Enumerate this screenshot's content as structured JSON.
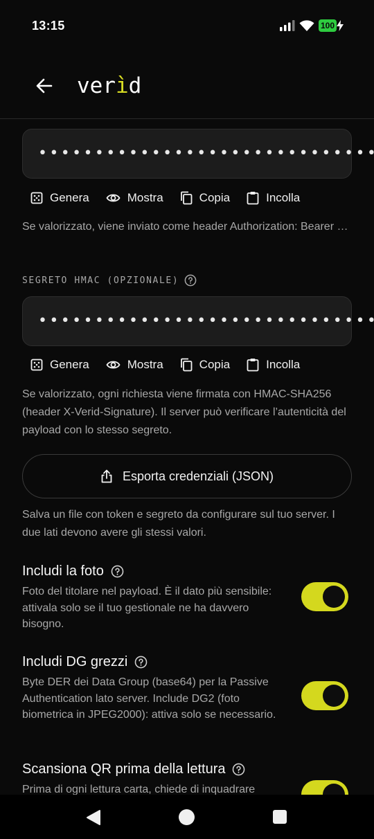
{
  "status": {
    "time": "13:15",
    "battery": "100"
  },
  "appbar": {
    "brand_prefix": "ver",
    "brand_accent": "ì",
    "brand_suffix": "d"
  },
  "token": {
    "masked_value": "••••••••••••••••••••••••••••••••",
    "actions": {
      "generate": "Genera",
      "show": "Mostra",
      "copy": "Copia",
      "paste": "Incolla"
    },
    "help": "Se valorizzato, viene inviato come header Authorization: Bearer …"
  },
  "hmac": {
    "label": "SEGRETO HMAC (OPZIONALE)",
    "masked_value": "••••••••••••••••••••••••••••••••",
    "actions": {
      "generate": "Genera",
      "show": "Mostra",
      "copy": "Copia",
      "paste": "Incolla"
    },
    "help": "Se valorizzato, ogni richiesta viene firmata con HMAC-SHA256 (header X-Verid-Signature). Il server può verificare l’autenticità del payload con lo stesso segreto."
  },
  "export": {
    "button_label": "Esporta credenziali (JSON)",
    "help": "Salva un file con token e segreto da configurare sul tuo server. I due lati devono avere gli stessi valori."
  },
  "options": [
    {
      "title": "Includi la foto",
      "desc": "Foto del titolare nel payload. È il dato più sensibile: attivala solo se il tuo gestionale ne ha davvero bisogno.",
      "enabled": true
    },
    {
      "title": "Includi DG grezzi",
      "desc": "Byte DER dei Data Group (base64) per la Passive Authentication lato server. Include DG2 (foto biometrica in JPEG2000): attiva solo se necessario.",
      "enabled": true
    },
    {
      "title": "Scansiona QR prima della lettura",
      "desc": "Prima di ogni lettura carta, chiede di inquadrare",
      "enabled": true
    }
  ],
  "colors": {
    "accent": "#d4d81e",
    "background": "#0a0a0a",
    "field": "#1c1c1c",
    "muted_text": "#a8a8a8"
  }
}
